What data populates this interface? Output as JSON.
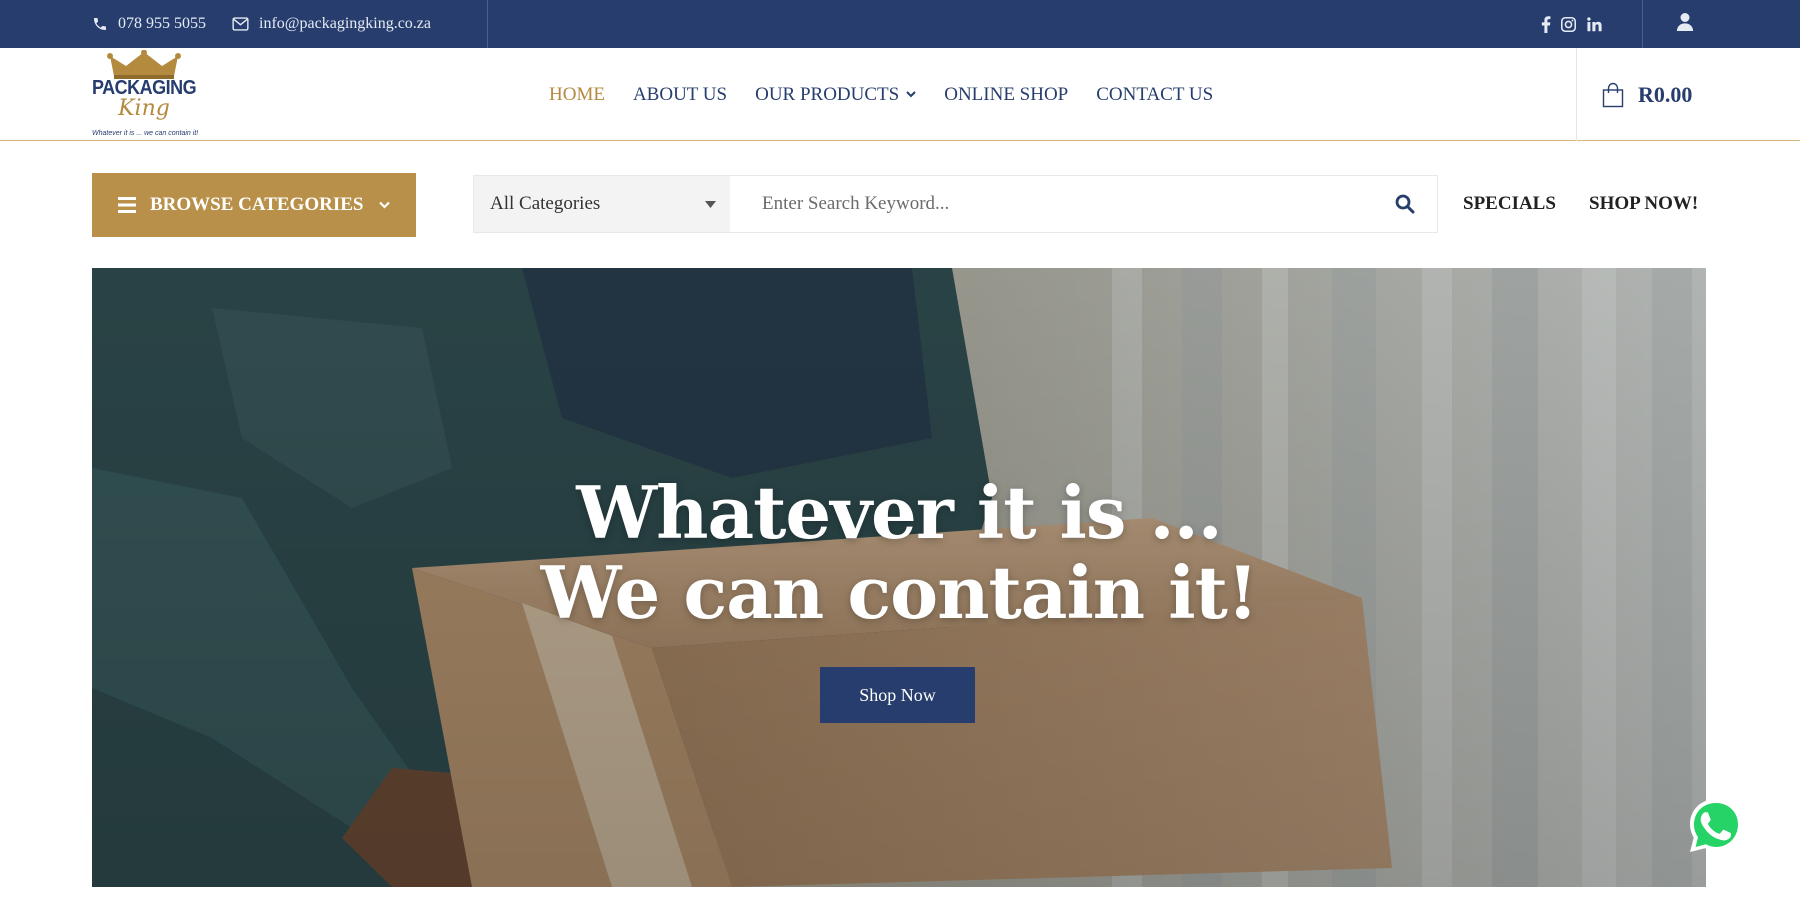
{
  "topbar": {
    "phone": "078 955 5055",
    "email": "info@packagingking.co.za",
    "social": [
      "facebook-icon",
      "instagram-icon",
      "linkedin-icon"
    ]
  },
  "logo": {
    "line1": "PACKAGING",
    "line2": "King",
    "tagline": "Whatever it is ... we can contain it!"
  },
  "nav": {
    "items": [
      {
        "label": "HOME",
        "active": true
      },
      {
        "label": "ABOUT US"
      },
      {
        "label": "OUR PRODUCTS",
        "dropdown": true
      },
      {
        "label": "ONLINE SHOP"
      },
      {
        "label": "CONTACT US"
      }
    ]
  },
  "cart": {
    "amount": "R0.00"
  },
  "browse": {
    "label": "BROWSE CATEGORIES"
  },
  "search": {
    "category": "All Categories",
    "placeholder": "Enter Search Keyword..."
  },
  "quick_links": [
    "SPECIALS",
    "SHOP NOW!"
  ],
  "hero": {
    "line1": "Whatever it is ...",
    "line2": "We can contain it!",
    "cta": "Shop Now"
  },
  "colors": {
    "navy": "#263d6e",
    "gold": "#b8904a",
    "whatsapp": "#25d366"
  }
}
